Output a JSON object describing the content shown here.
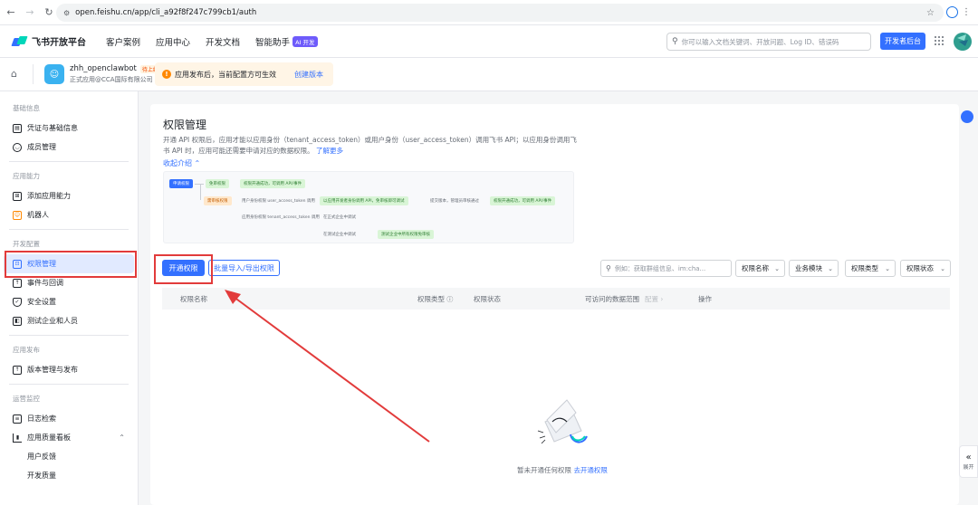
{
  "browser": {
    "url": "open.feishu.cn/app/cli_a92f8f247c799cb1/auth"
  },
  "header": {
    "brand": "飞书开放平台",
    "nav": [
      "客户案例",
      "应用中心",
      "开发文档",
      "智能助手"
    ],
    "ai_badge": "AI 开发",
    "search_placeholder": "你可以输入文档关键词、开放问题、Log ID、错误码",
    "dev_console": "开发者后台"
  },
  "app": {
    "name": "zhh_openclawbot",
    "status_badge": "待上线",
    "subtitle": "正式应用@CCA国际有限公司",
    "notice": "应用发布后，当前配置方可生效",
    "notice_link": "创建版本"
  },
  "sidebar": {
    "sections": [
      {
        "title": "基础信息",
        "items": [
          {
            "label": "凭证与基础信息",
            "icon": "credential-icon"
          },
          {
            "label": "成员管理",
            "icon": "member-icon"
          }
        ]
      },
      {
        "title": "应用能力",
        "items": [
          {
            "label": "添加应用能力",
            "icon": "capability-icon"
          },
          {
            "label": "机器人",
            "icon": "robot-icon"
          }
        ]
      },
      {
        "title": "开发配置",
        "items": [
          {
            "label": "权限管理",
            "icon": "permission-icon",
            "active": true
          },
          {
            "label": "事件与回调",
            "icon": "event-icon"
          },
          {
            "label": "安全设置",
            "icon": "shield-icon"
          },
          {
            "label": "测试企业和人员",
            "icon": "test-icon"
          }
        ]
      },
      {
        "title": "应用发布",
        "items": [
          {
            "label": "版本管理与发布",
            "icon": "release-icon"
          }
        ]
      },
      {
        "title": "运营监控",
        "items": [
          {
            "label": "日志检索",
            "icon": "log-icon"
          },
          {
            "label": "应用质量看板",
            "icon": "chart-icon"
          }
        ]
      }
    ],
    "sub_items": [
      "用户反馈",
      "开发质量"
    ]
  },
  "main": {
    "title": "权限管理",
    "description": "开通 API 权限后，应用才能以应用身份（tenant_access_token）或用户身份（user_access_token）调用飞书 API；以应用身份调用飞书 API 时，应用可能还需要申请对应的数据权限。",
    "learn_more": "了解更多",
    "collapse": "收起介绍 ⌃",
    "diagram": {
      "start": "申请权限",
      "n1": "免审权限",
      "n1r": "权限开通成功，可调用 API/事件",
      "n2": "需审核权限",
      "n2a": "用户身份权限 user_access_token 调用",
      "n2b": "以应用开发者身份调用 API，免审核即可调试",
      "n2c": "提交版本，管理员审核通过",
      "n2d": "权限开通成功，可调用 API/事件",
      "n3": "应用身份权限 tenant_access_token 调用",
      "n3a": "在正式企业中调试",
      "n4": "在测试企业中调试",
      "n4a": "测试企业中所有权限免审核"
    },
    "btn_open": "开通权限",
    "btn_batch": "批量导入/导出权限",
    "filter_placeholder": "例如：获取群组信息、im:cha...",
    "filters": [
      "权限名称",
      "业务模块",
      "权限类型",
      "权限状态"
    ],
    "columns": [
      "权限名称",
      "权限类型",
      "权限状态",
      "可访问的数据范围",
      "配置",
      "操作"
    ],
    "empty_text": "暂未开通任何权限",
    "empty_link": "去开通权限"
  },
  "side": {
    "expand": "展开"
  },
  "colors": {
    "brand": "#3370ff",
    "highlight": "#e23b3b"
  }
}
